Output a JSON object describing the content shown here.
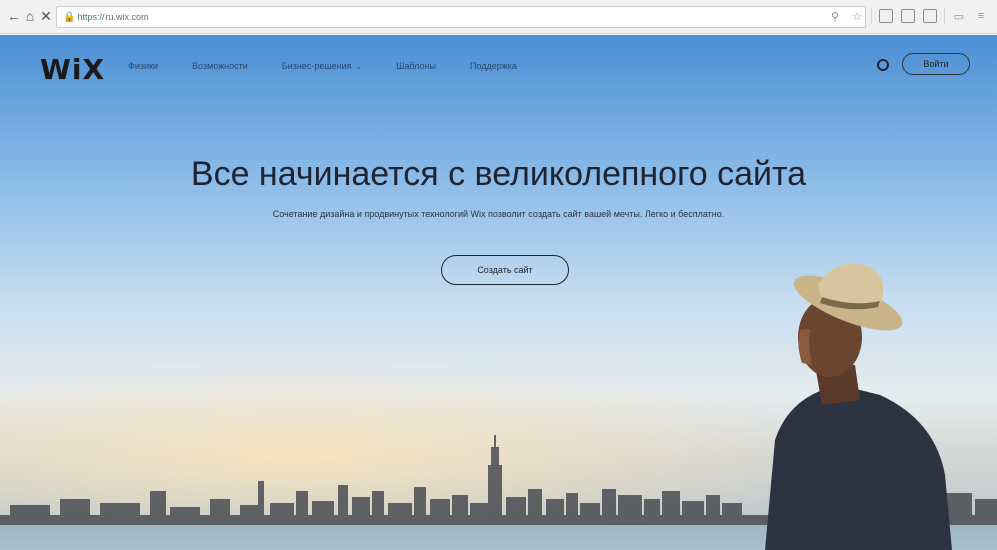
{
  "browser": {
    "url_scheme": "https://",
    "url_host": "ru.wix.com",
    "icons": [
      "back-arrow-icon",
      "home-icon",
      "close-icon",
      "lock-icon",
      "profile-icon",
      "star-icon",
      "reading-list-icon",
      "split-view-icon",
      "tabs-icon",
      "comment-icon",
      "menu-icon"
    ]
  },
  "header": {
    "logo": "WiX",
    "menu": [
      {
        "label": "Физики"
      },
      {
        "label": "Возможности"
      },
      {
        "label": "Бизнес-решения",
        "has_dropdown": true
      },
      {
        "label": "Шаблоны"
      },
      {
        "label": "Поддержка"
      }
    ],
    "login_label": "Войти"
  },
  "hero": {
    "title": "Все начинается с великолепного сайта",
    "subtitle": "Сочетание дизайна и продвинутых технологий Wix позволит создать сайт вашей мечты. Легко и бесплатно.",
    "cta_label": "Создать сайт"
  },
  "colors": {
    "sky_top": "#4b8fd4",
    "sky_mid": "#c7ddf0",
    "text_dark": "#1e2432"
  }
}
